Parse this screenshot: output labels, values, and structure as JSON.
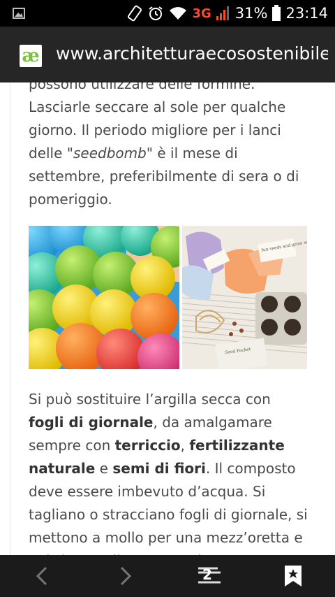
{
  "status": {
    "network": "3G",
    "battery": "31%",
    "time": "23:14"
  },
  "browser": {
    "url": "www.architetturaecosostenibile.",
    "logo_text": "æ"
  },
  "article": {
    "p1_line0": "possono utilizzare delle formine.",
    "p1_line1": "Lasciarle seccare al sole per qualche",
    "p1_line2": "giorno. Il periodo migliore per i lanci",
    "p1_line3_a": "delle \"",
    "p1_line3_b": "seedbomb",
    "p1_line3_c": "\" è il mese di",
    "p1_line4": "settembre, preferibilmente di sera o di",
    "p1_line5": "pomeriggio.",
    "p2_a": "Si può sostituire l’argilla secca con ",
    "p2_b": "fogli di giornale",
    "p2_c": ", da amalgamare sempre con ",
    "p2_d": "terriccio",
    "p2_e": ", ",
    "p2_f": "fertilizzante naturale",
    "p2_g": " e ",
    "p2_h": "semi di fiori",
    "p2_i": ". Il composto deve essere imbevuto d’acqua. Si tagliano o stracciano fogli di giornale, si mettono a mollo per una mezz’oretta e poi si versa il composto in"
  },
  "image2": {
    "tag_text": "fun seeds and grow wild",
    "card_text": "Seed Packet"
  },
  "navbar": {
    "tabs_count": "2"
  }
}
